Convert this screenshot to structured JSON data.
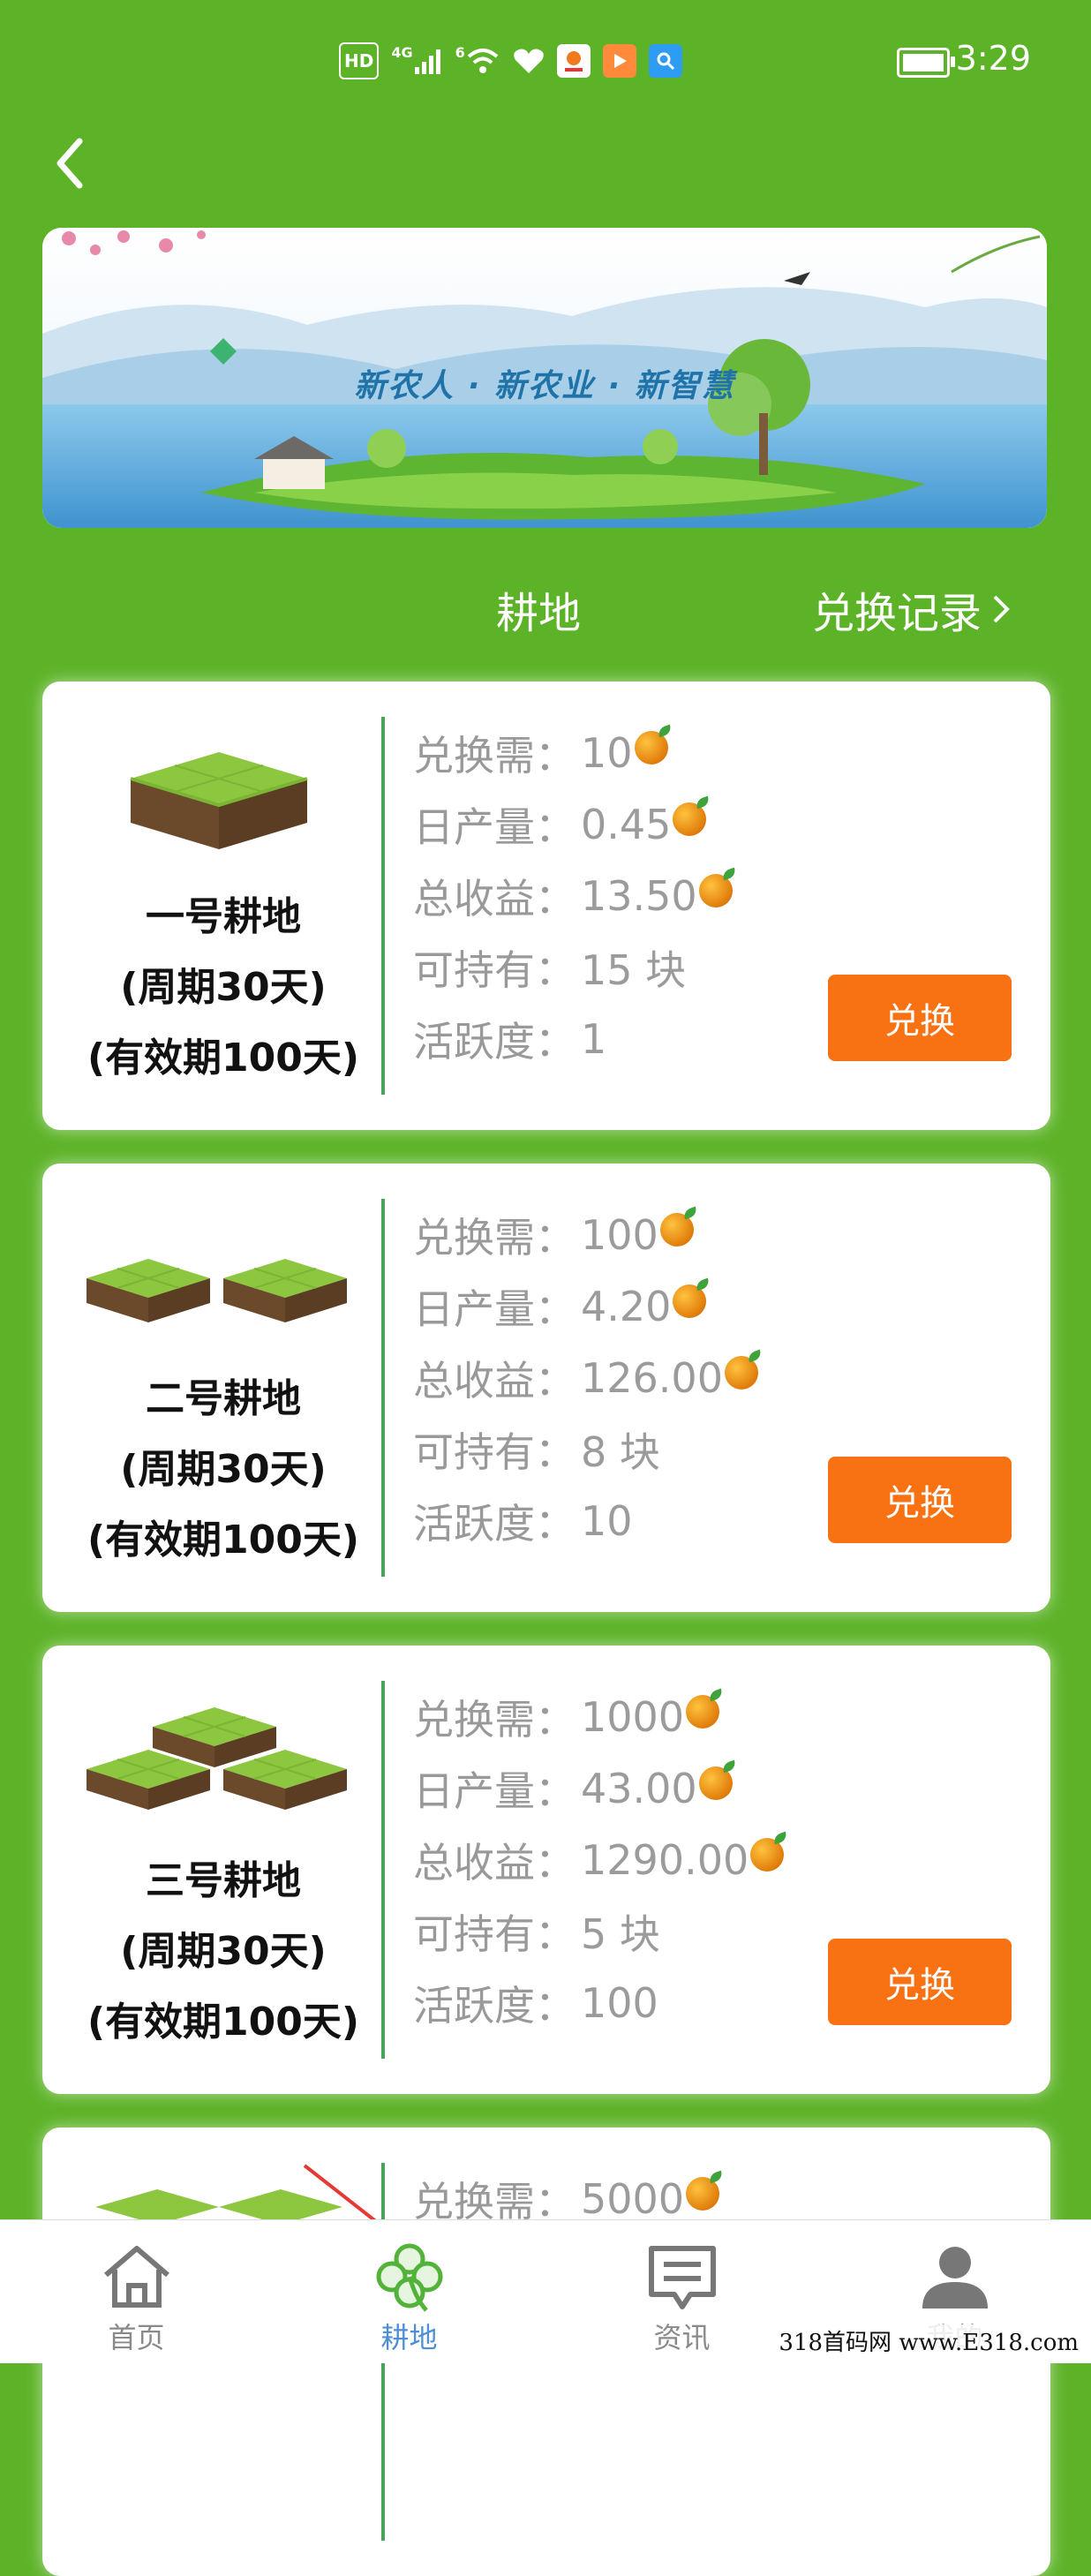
{
  "status": {
    "time": "3:29",
    "hd": "HD",
    "net": "4G",
    "net2": "6"
  },
  "banner": {
    "slogan": "新农人 · 新农业 · 新智慧"
  },
  "header": {
    "title": "耕地",
    "record_link": "兑换记录"
  },
  "labels": {
    "price": "兑换需：",
    "daily": "日产量：",
    "total": "总收益：",
    "hold": "可持有：",
    "active": "活跃度：",
    "button": "兑换"
  },
  "plots": [
    {
      "name": "一号耕地",
      "cycle": "(周期30天)",
      "validity": "(有效期100天)",
      "price": "10",
      "daily": "0.45",
      "total": "13.50",
      "hold": "15 块",
      "active": "1",
      "tiles": 1
    },
    {
      "name": "二号耕地",
      "cycle": "(周期30天)",
      "validity": "(有效期100天)",
      "price": "100",
      "daily": "4.20",
      "total": "126.00",
      "hold": "8 块",
      "active": "10",
      "tiles": 2
    },
    {
      "name": "三号耕地",
      "cycle": "(周期30天)",
      "validity": "(有效期100天)",
      "price": "1000",
      "daily": "43.00",
      "total": "1290.00",
      "hold": "5 块",
      "active": "100",
      "tiles": 3
    },
    {
      "price": "5000"
    }
  ],
  "nav": {
    "home": "首页",
    "farmland": "耕地",
    "news": "资讯",
    "mine": "我的"
  },
  "watermark": "318首码网 www.E318.com",
  "colors": {
    "background": "#5db328",
    "button": "#f87214",
    "nav_active": "#4f8fd6"
  }
}
